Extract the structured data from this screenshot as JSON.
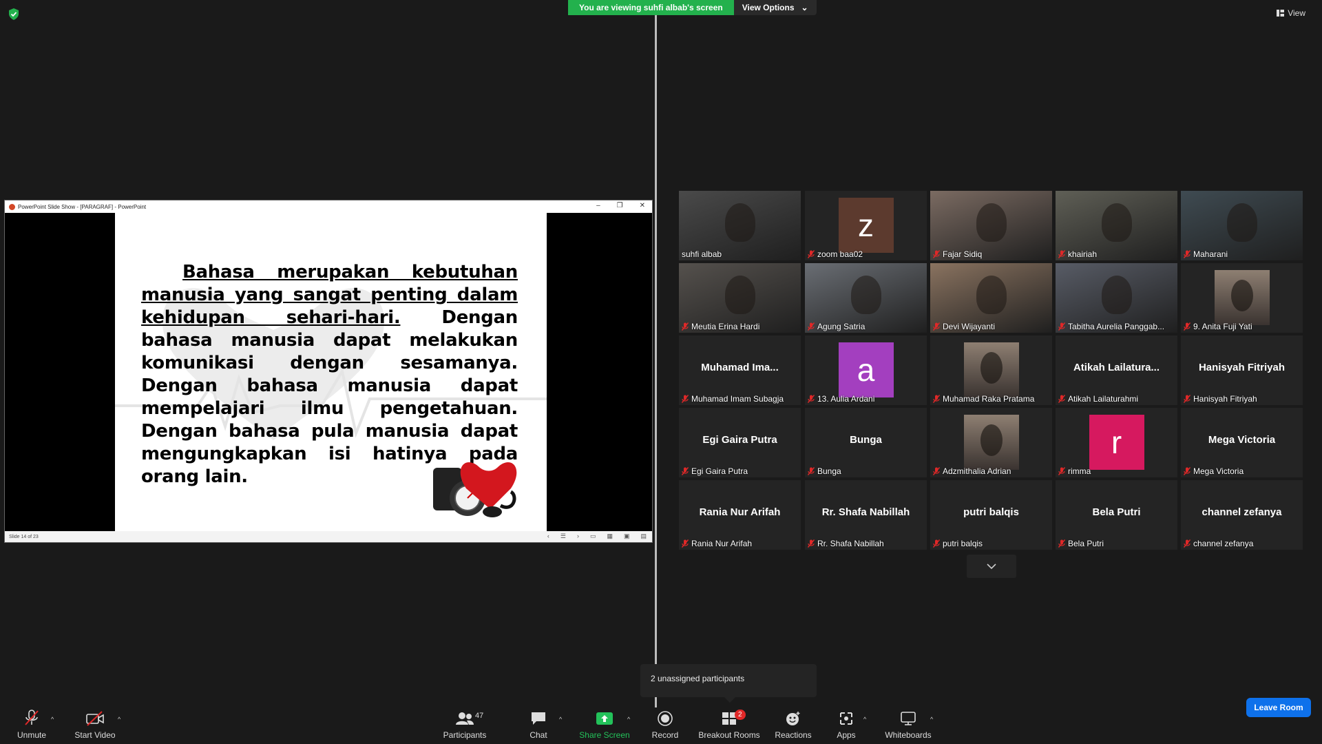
{
  "banner": {
    "viewing_text": "You are viewing suhfi albab's screen",
    "view_options_label": "View Options"
  },
  "view_label": "View",
  "share_window": {
    "title": "PowerPoint Slide Show - [PARAGRAF] - PowerPoint",
    "slide_status": "Slide 14 of 23",
    "paragraph_underlined": "Bahasa merupakan kebutuhan manusia yang sangat penting dalam kehidupan sehari-hari.",
    "paragraph_rest": " Dengan bahasa manusia dapat melakukan komunikasi dengan sesamanya. Dengan bahasa manusia dapat mempelajari ilmu pengetahuan. Dengan bahasa pula manusia dapat mengungkapkan isi hatinya pada orang lain."
  },
  "participants": [
    {
      "name": "suhfi albab",
      "kind": "video",
      "active": true,
      "muted": false
    },
    {
      "name": "zoom baa02",
      "kind": "avatar",
      "letter": "z",
      "color": "#5c3a2e",
      "muted": true
    },
    {
      "name": "Fajar Sidiq",
      "kind": "video",
      "muted": true
    },
    {
      "name": "khairiah",
      "kind": "video",
      "muted": true
    },
    {
      "name": "Maharani",
      "kind": "video",
      "muted": true
    },
    {
      "name": "Meutia Erina Hardi",
      "kind": "video",
      "muted": true
    },
    {
      "name": "Agung Satria",
      "kind": "video",
      "muted": true
    },
    {
      "name": "Devi Wijayanti",
      "kind": "video",
      "muted": true
    },
    {
      "name": "Tabitha Aurelia Panggab...",
      "kind": "video",
      "muted": true
    },
    {
      "name": "9. Anita Fuji Yati",
      "kind": "photo",
      "muted": true
    },
    {
      "name": "Muhamad Imam Subagja",
      "kind": "text",
      "big": "Muhamad  Ima...",
      "muted": true
    },
    {
      "name": "13. Aulia Ardani",
      "kind": "avatar",
      "letter": "a",
      "color": "#a33fbf",
      "muted": true
    },
    {
      "name": "Muhamad Raka Pratama",
      "kind": "photo",
      "muted": true
    },
    {
      "name": "Atikah Lailaturahmi",
      "kind": "text",
      "big": "Atikah  Lailatura...",
      "muted": true
    },
    {
      "name": "Hanisyah Fitriyah",
      "kind": "text",
      "big": "Hanisyah Fitriyah",
      "muted": true
    },
    {
      "name": "Egi Gaira Putra",
      "kind": "text",
      "big": "Egi Gaira Putra",
      "muted": true
    },
    {
      "name": "Bunga",
      "kind": "text",
      "big": "Bunga",
      "muted": true
    },
    {
      "name": "Adzmithalia Adrian",
      "kind": "photo",
      "muted": true
    },
    {
      "name": "rimma",
      "kind": "avatar",
      "letter": "r",
      "color": "#d6195f",
      "muted": true
    },
    {
      "name": "Mega Victoria",
      "kind": "text",
      "big": "Mega Victoria",
      "muted": true
    },
    {
      "name": "Rania Nur Arifah",
      "kind": "text",
      "big": "Rania Nur Arifah",
      "muted": true
    },
    {
      "name": "Rr. Shafa Nabillah",
      "kind": "text",
      "big": "Rr. Shafa Nabillah",
      "muted": true
    },
    {
      "name": "putri balqis",
      "kind": "text",
      "big": "putri balqis",
      "muted": true
    },
    {
      "name": "Bela Putri",
      "kind": "text",
      "big": "Bela Putri",
      "muted": true
    },
    {
      "name": "channel zefanya",
      "kind": "text",
      "big": "channel zefanya",
      "muted": true
    }
  ],
  "popup": {
    "text": "2 unassigned participants"
  },
  "toolbar": {
    "unmute": "Unmute",
    "start_video": "Start Video",
    "participants": "Participants",
    "participants_count": "47",
    "chat": "Chat",
    "share_screen": "Share Screen",
    "record": "Record",
    "breakout_rooms": "Breakout Rooms",
    "breakout_badge": "2",
    "reactions": "Reactions",
    "apps": "Apps",
    "whiteboards": "Whiteboards",
    "leave_room": "Leave Room"
  },
  "colors": {
    "accent_green": "#23b14d",
    "leave_blue": "#0e71eb",
    "active_speaker": "#d7e35f",
    "muted_red": "#e02828"
  }
}
